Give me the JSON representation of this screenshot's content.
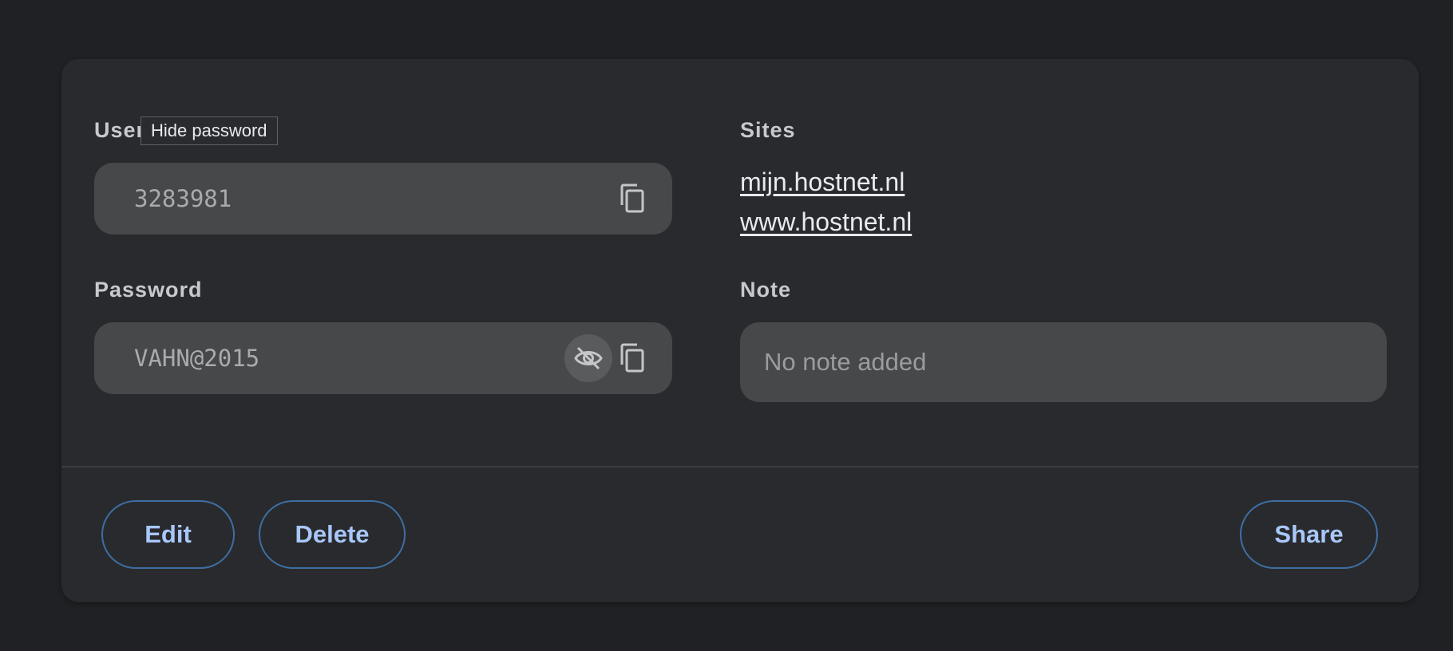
{
  "tooltip": {
    "text": "Hide password"
  },
  "username": {
    "label": "Username",
    "value": "3283981",
    "copy_icon": "copy-icon"
  },
  "password": {
    "label": "Password",
    "value": "VAHN@2015",
    "toggle_icon": "eye-off-icon",
    "copy_icon": "copy-icon"
  },
  "sites": {
    "label": "Sites",
    "items": [
      "mijn.hostnet.nl",
      "www.hostnet.nl"
    ]
  },
  "note": {
    "label": "Note",
    "value": "No note added"
  },
  "actions": {
    "edit": "Edit",
    "delete": "Delete",
    "share": "Share"
  },
  "colors": {
    "background": "#202124",
    "card": "#292a2d",
    "field": "#474849",
    "accent": "#a8c7fa",
    "button_border": "#3d6fa3"
  }
}
